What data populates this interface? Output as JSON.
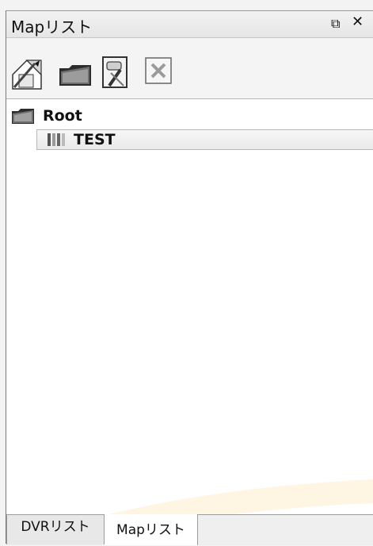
{
  "panel": {
    "title": "Mapリスト",
    "float_icon": "⧉",
    "close_icon": "✕"
  },
  "toolbar": {
    "buttons": [
      {
        "icon": "new-map-icon"
      },
      {
        "icon": "folder-icon"
      },
      {
        "icon": "edit-map-icon"
      },
      {
        "icon": "delete-icon"
      }
    ]
  },
  "tree": {
    "root": {
      "label": "Root",
      "icon": "folder-icon"
    },
    "children": [
      {
        "label": "TEST",
        "icon": "map-icon"
      }
    ]
  },
  "tabs": [
    {
      "label": "DVRリスト"
    },
    {
      "label": "Mapリスト",
      "active": true
    }
  ],
  "colors": {
    "watermark": "#f6c64a"
  }
}
